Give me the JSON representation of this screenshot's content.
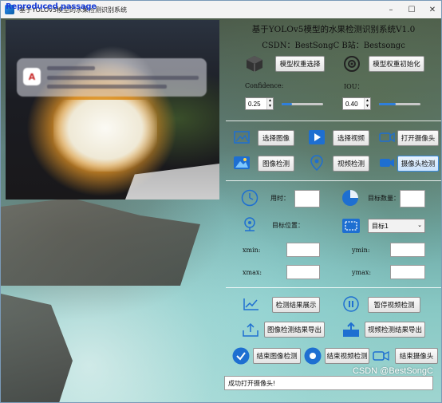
{
  "window": {
    "title": "基于YOLOv5模型的水果检测识别系统",
    "overlay_text": "Reproduced passage",
    "controls": {
      "minimize": "–",
      "maximize": "☐",
      "close": "✕"
    }
  },
  "video": {
    "notification_icon_letter": "A"
  },
  "panel": {
    "title": "基于YOLOv5模型的水果检测识别系统V1.0",
    "subtitle": "CSDN：BestSongC   B站：Bestsongc"
  },
  "model": {
    "select_label": "模型权重选择",
    "init_label": "模型权重初始化",
    "confidence_label": "Confidence:",
    "iou_label": "IOU：",
    "confidence_value": "0.25",
    "iou_value": "0.40",
    "confidence_fraction": 0.25,
    "iou_fraction": 0.4
  },
  "actions": {
    "select_image": "选择图像",
    "select_video": "选择视频",
    "open_camera": "打开摄像头",
    "image_detect": "图像检测",
    "video_detect": "视频检测",
    "camera_detect": "摄像头检测"
  },
  "results": {
    "time_label": "用时：",
    "target_count_label": "目标数量：",
    "target_pos_label": "目标位置：",
    "target_select_value": "目标1",
    "xmin_label": "xmin:",
    "ymin_label": "ymin:",
    "xmax_label": "xmax:",
    "ymax_label": "ymax:"
  },
  "bottom": {
    "show_results": "检测结果展示",
    "pause_video": "暂停视频检测",
    "export_image": "图像检测结果导出",
    "export_video": "视频检测结果导出",
    "end_image": "结束图像检测",
    "end_video": "结束视频检测",
    "end_camera": "结束摄像头"
  },
  "status": {
    "message": "成功打开摄像头!"
  },
  "watermark": "CSDN @BestSongC",
  "colors": {
    "accent": "#2f7fdc",
    "active_border": "#3a8be0"
  }
}
